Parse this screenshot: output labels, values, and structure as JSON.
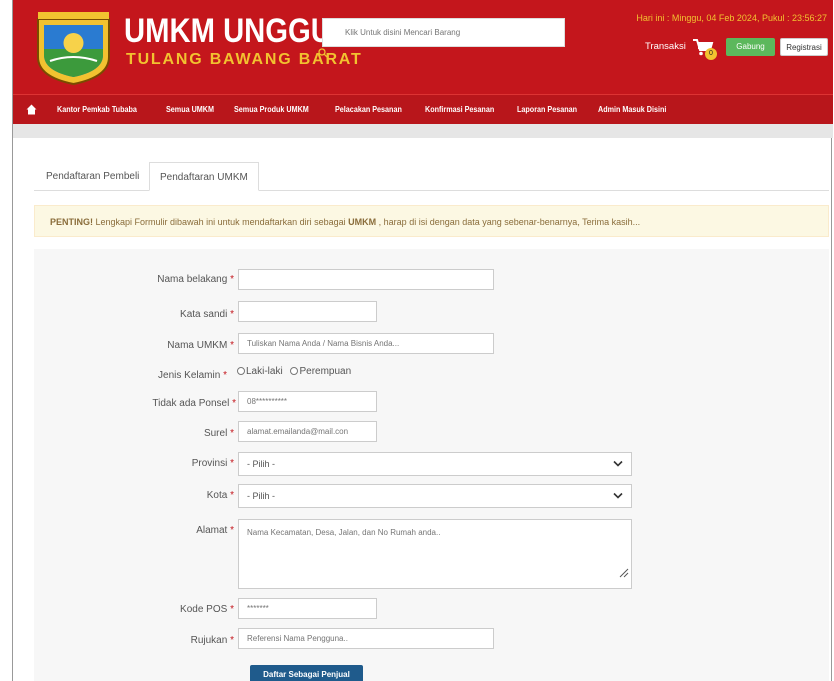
{
  "header": {
    "brand_title": "UMKM UNGGULAN",
    "brand_subtitle": "TULANG BAWANG BARAT",
    "search_placeholder": "Klik Untuk disini Mencari Barang",
    "date_text": "Hari ini : Minggu, 04 Feb 2024, Pukul : 23:56:27",
    "transaksi_label": "Transaksi",
    "cart_count": "0",
    "gabung_label": "Gabung",
    "registrasi_label": "Registrasi",
    "logo_text": "TULANG BAWANG BARAT"
  },
  "nav": {
    "items": [
      "Kantor Pemkab Tubaba",
      "Semua UMKM",
      "Semua Produk UMKM",
      "Pelacakan Pesanan",
      "Konfirmasi Pesanan",
      "Laporan Pesanan",
      "Admin Masuk Disini"
    ]
  },
  "tabs": {
    "pembeli": "Pendaftaran Pembeli",
    "umkm": "Pendaftaran UMKM"
  },
  "alert": {
    "strong1": "PENTING!",
    "text1": " Lengkapi Formulir dibawah ini untuk mendaftarkan diri sebagai ",
    "strong2": "UMKM",
    "text2": " , harap di isi dengan data yang sebenar-benarnya, Terima kasih..."
  },
  "form": {
    "required_mark": "*",
    "nama_belakang": {
      "label": "Nama belakang",
      "value": ""
    },
    "kata_sandi": {
      "label": "Kata sandi",
      "value": ""
    },
    "nama_umkm": {
      "label": "Nama UMKM",
      "placeholder": "Tuliskan Nama Anda / Nama Bisnis Anda..."
    },
    "jenis_kelamin": {
      "label": "Jenis Kelamin",
      "option_laki": "Laki-laki",
      "option_perempuan": "Perempuan"
    },
    "ponsel": {
      "label": "Tidak ada Ponsel",
      "placeholder": "08**********"
    },
    "surel": {
      "label": "Surel",
      "placeholder": "alamat.emailanda@mail.con"
    },
    "provinsi": {
      "label": "Provinsi",
      "selected": "- Pilih -"
    },
    "kota": {
      "label": "Kota",
      "selected": "- Pilih -"
    },
    "alamat": {
      "label": "Alamat",
      "placeholder": "Nama Kecamatan, Desa, Jalan, dan No Rumah anda.."
    },
    "kode_pos": {
      "label": "Kode POS",
      "placeholder": "*******"
    },
    "rujukan": {
      "label": "Rujukan",
      "placeholder": "Referensi Nama Pengguna.."
    },
    "submit_label": "Daftar Sebagai Penjual"
  },
  "colors": {
    "header_red": "#c4161c",
    "brand_gold": "#f2c230",
    "gabung_green": "#5cb85c",
    "submit_blue": "#1f5b8c"
  }
}
